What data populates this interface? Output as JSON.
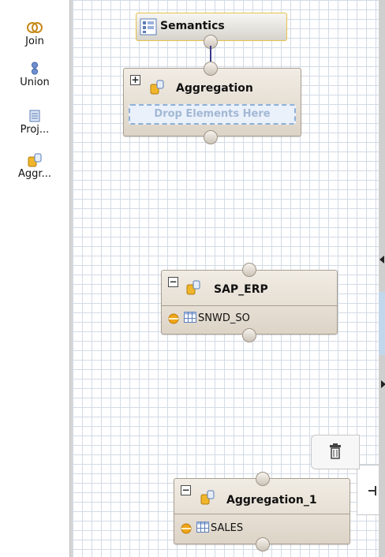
{
  "palette": {
    "items": [
      {
        "label": "Join",
        "icon": "join-icon"
      },
      {
        "label": "Union",
        "icon": "union-icon"
      },
      {
        "label": "Proj...",
        "icon": "projection-icon"
      },
      {
        "label": "Aggr...",
        "icon": "aggregation-icon"
      }
    ]
  },
  "canvas": {
    "semantics": {
      "title": "Semantics"
    },
    "aggregation": {
      "title": "Aggregation",
      "drop_text": "Drop Elements Here",
      "expander": "+"
    },
    "sap_erp": {
      "title": "SAP_ERP",
      "expander": "−",
      "table": "SNWD_SO"
    },
    "aggregation_1": {
      "title": "Aggregation_1",
      "expander": "−",
      "table": "SALES"
    }
  },
  "colors": {
    "accent_gold": "#f0b52a",
    "connector": "#3a3a8a",
    "drop_border": "#8fb0d8"
  }
}
